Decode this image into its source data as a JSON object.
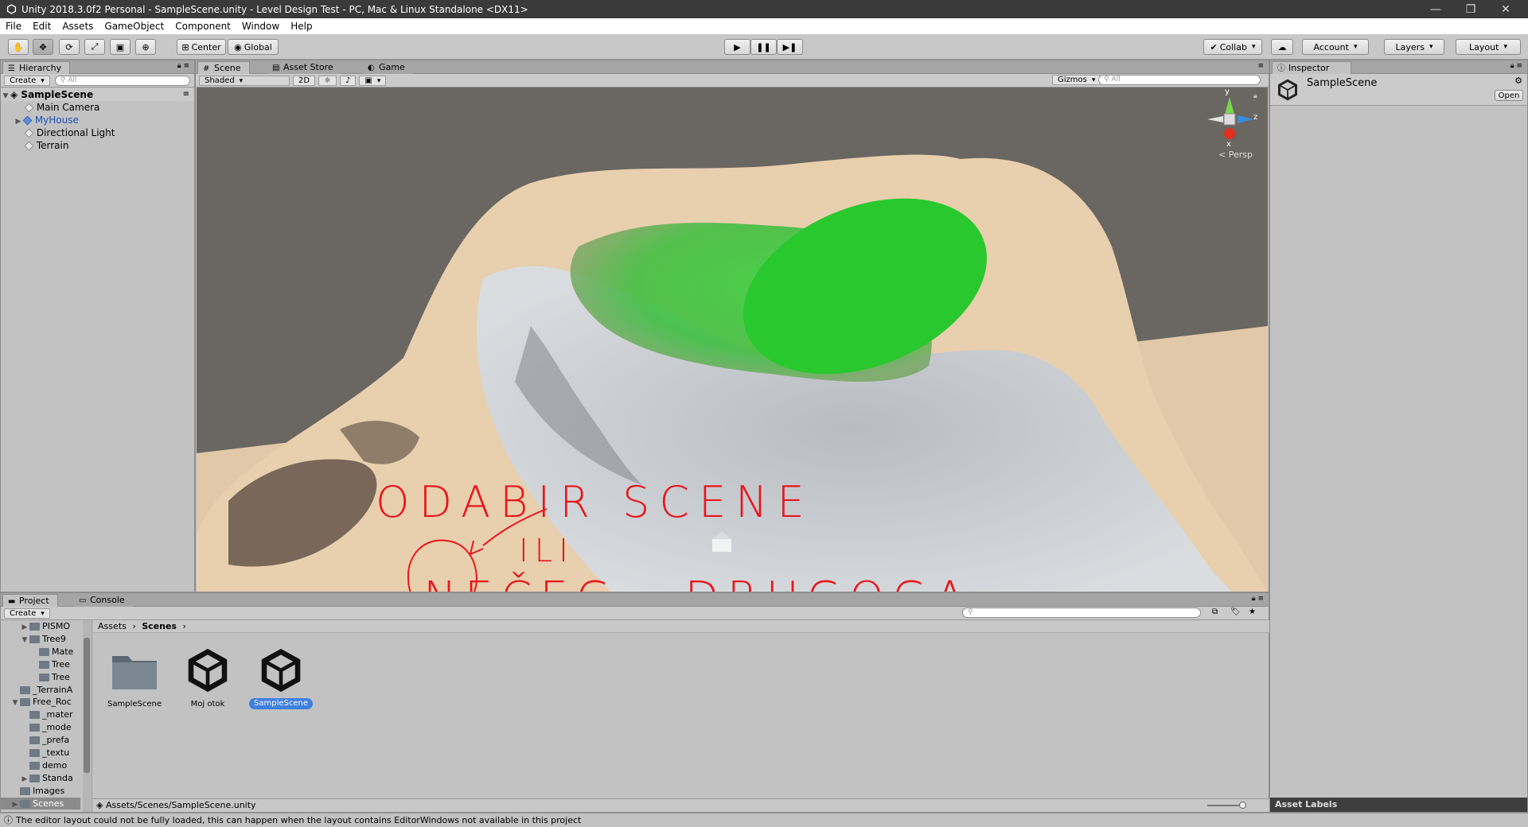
{
  "window": {
    "title": "Unity 2018.3.0f2 Personal - SampleScene.unity - Level Design Test - PC, Mac & Linux Standalone <DX11>",
    "controls": [
      "—",
      "❐",
      "✕"
    ]
  },
  "menu": [
    "File",
    "Edit",
    "Assets",
    "GameObject",
    "Component",
    "Window",
    "Help"
  ],
  "toolbar": {
    "pivot": "Center",
    "space": "Global",
    "collab": "Collab",
    "account": "Account",
    "layers": "Layers",
    "layout": "Layout"
  },
  "hierarchy": {
    "tab": "Hierarchy",
    "create": "Create",
    "search_placeholder": "All",
    "scene": "SampleScene",
    "items": [
      "Main Camera",
      "MyHouse",
      "Directional Light",
      "Terrain"
    ]
  },
  "scene_view": {
    "tabs": [
      "Scene",
      "Asset Store",
      "Game"
    ],
    "shading": "Shaded",
    "mode_2d": "2D",
    "gizmos": "Gizmos",
    "search_placeholder": "All",
    "gizmo_axes": {
      "y": "y",
      "z": "z",
      "x": "x"
    },
    "projection": "Persp",
    "annotation_lines": [
      "ODABIR  SCENE",
      "ILI",
      "NEČEG   DRUGOGA"
    ]
  },
  "inspector": {
    "tab": "Inspector",
    "title": "SampleScene",
    "open_button": "Open",
    "asset_labels": "Asset Labels"
  },
  "project": {
    "tabs": [
      "Project",
      "Console"
    ],
    "create": "Create",
    "tree": [
      {
        "label": "PISMO",
        "indent": 2,
        "arrow": "▶"
      },
      {
        "label": "Tree9",
        "indent": 2,
        "arrow": "▼"
      },
      {
        "label": "Mate",
        "indent": 3,
        "arrow": ""
      },
      {
        "label": "Tree",
        "indent": 3,
        "arrow": ""
      },
      {
        "label": "Tree",
        "indent": 3,
        "arrow": ""
      },
      {
        "label": "_TerrainA",
        "indent": 1,
        "arrow": ""
      },
      {
        "label": "Free_Roc",
        "indent": 1,
        "arrow": "▼"
      },
      {
        "label": "_mater",
        "indent": 2,
        "arrow": ""
      },
      {
        "label": "_mode",
        "indent": 2,
        "arrow": ""
      },
      {
        "label": "_prefa",
        "indent": 2,
        "arrow": ""
      },
      {
        "label": "_textu",
        "indent": 2,
        "arrow": ""
      },
      {
        "label": "demo",
        "indent": 2,
        "arrow": ""
      },
      {
        "label": "Standa",
        "indent": 2,
        "arrow": "▶"
      },
      {
        "label": "Images",
        "indent": 1,
        "arrow": ""
      },
      {
        "label": "Scenes",
        "indent": 1,
        "arrow": "▶",
        "selected": true
      }
    ],
    "breadcrumb": [
      "Assets",
      "Scenes"
    ],
    "assets": [
      {
        "name": "SampleScene",
        "kind": "folder"
      },
      {
        "name": "Moj otok",
        "kind": "unity-scene"
      },
      {
        "name": "SampleScene",
        "kind": "unity-scene",
        "selected": true
      }
    ],
    "path": "Assets/Scenes/SampleScene.unity"
  },
  "status": "The editor layout could not be fully loaded, this can happen when the layout contains EditorWindows not available in this project",
  "colors": {
    "annotation": "#e8161b",
    "selection": "#3d80df",
    "unity_title": "#3a3a3a"
  }
}
